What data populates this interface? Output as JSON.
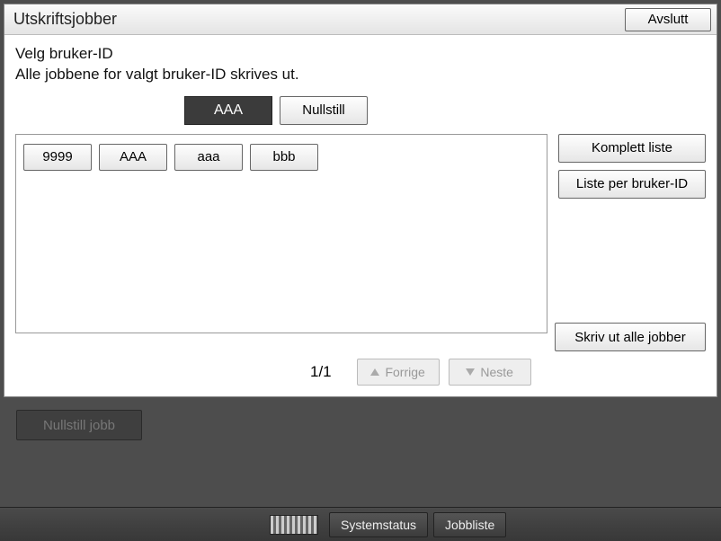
{
  "title": "Utskriftsjobber",
  "instructions": {
    "line1": "Velg bruker-ID",
    "line2": "Alle jobbene for valgt bruker-ID skrives ut."
  },
  "selected_user": "AAA",
  "users": [
    "9999",
    "AAA",
    "aaa",
    "bbb"
  ],
  "buttons": {
    "exit": "Avslutt",
    "reset": "Nullstill",
    "complete_list": "Komplett liste",
    "list_per_user": "Liste per bruker-ID",
    "print_all": "Skriv ut alle jobber"
  },
  "pager": {
    "page": "1/1",
    "prev": "Forrige",
    "next": "Neste"
  },
  "background": {
    "reset_job": "Nullstill jobb"
  },
  "bottombar": {
    "system_status": "Systemstatus",
    "job_list": "Jobbliste"
  }
}
